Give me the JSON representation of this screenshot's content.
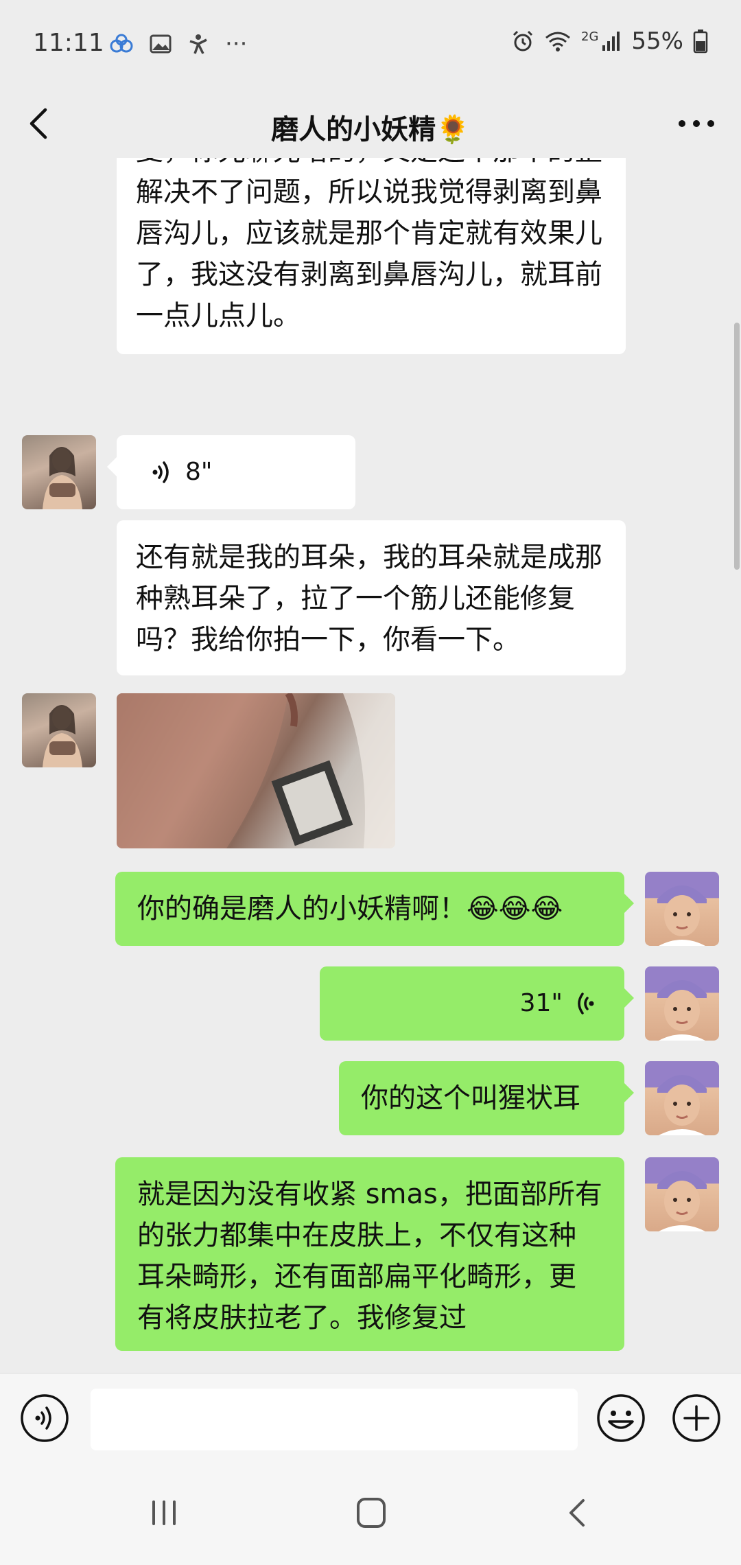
{
  "status_bar": {
    "time": "11:11",
    "network": "2G",
    "battery": "55%",
    "dots": "···"
  },
  "header": {
    "title": "磨人的小妖精🌻"
  },
  "messages": [
    {
      "side": "left",
      "type": "text",
      "text": "聊解决不了问题，你得找医生，你得修复，你光聊光啥的，又是这个那个的整解决不了问题，所以说我觉得剥离到鼻唇沟儿，应该就是那个肯定就有效果儿了，我这没有剥离到鼻唇沟儿，就耳前一点儿点儿。"
    },
    {
      "side": "left",
      "type": "voice",
      "duration": "8\""
    },
    {
      "side": "left",
      "type": "text",
      "text": "还有就是我的耳朵，我的耳朵就是成那种熟耳朵了，拉了一个筋儿还能修复吗？我给你拍一下，你看一下。"
    },
    {
      "side": "left",
      "type": "image"
    },
    {
      "side": "right",
      "type": "text",
      "text": "你的确是磨人的小妖精啊！😂😂😂"
    },
    {
      "side": "right",
      "type": "voice",
      "duration": "31\""
    },
    {
      "side": "right",
      "type": "text",
      "text": "你的这个叫猩状耳"
    },
    {
      "side": "right",
      "type": "text",
      "text": "就是因为没有收紧 smas，把面部所有的张力都集中在皮肤上，不仅有这种耳朵畸形，还有面部扁平化畸形，更有将皮肤拉老了。我修复过"
    }
  ],
  "colors": {
    "background": "#ededed",
    "bubble_left": "#ffffff",
    "bubble_right": "#95ec69"
  }
}
